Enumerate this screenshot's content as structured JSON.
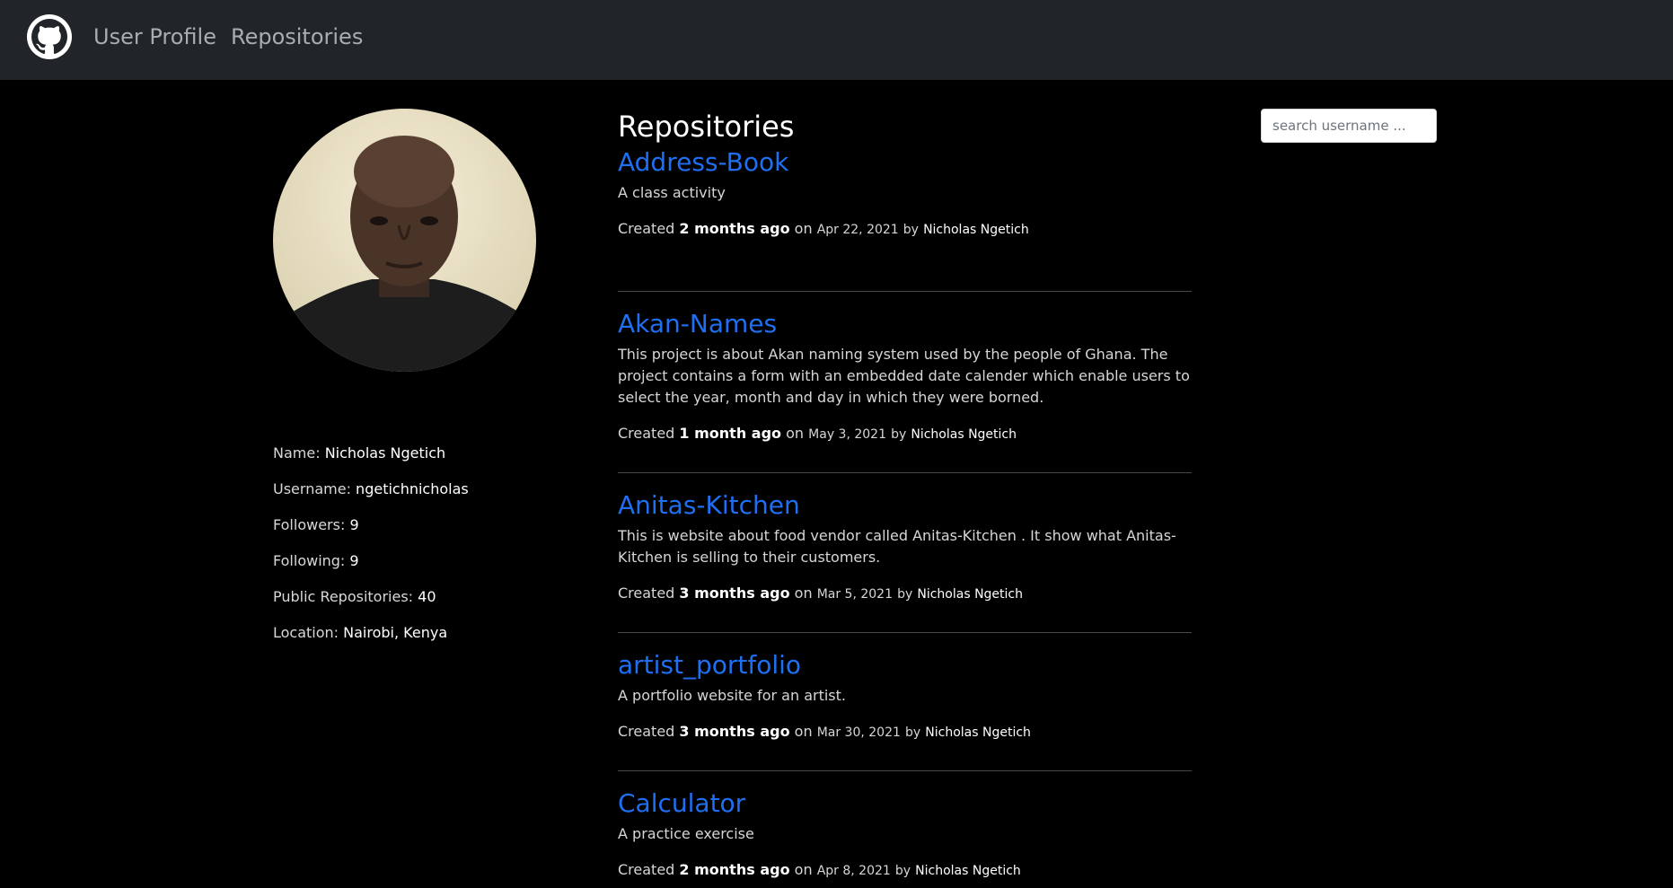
{
  "nav": {
    "brand_icon": "github-icon",
    "links": [
      "User Profile",
      "Repositories"
    ]
  },
  "profile": {
    "avatar_alt": "profile-photo",
    "fields": [
      {
        "label": "Name:",
        "value": "Nicholas Ngetich"
      },
      {
        "label": "Username:",
        "value": "ngetichnicholas"
      },
      {
        "label": "Followers:",
        "value": "9"
      },
      {
        "label": "Following:",
        "value": "9"
      },
      {
        "label": "Public Repositories:",
        "value": "40"
      },
      {
        "label": "Location:",
        "value": "Nairobi, Kenya"
      }
    ]
  },
  "search": {
    "placeholder": "search username ..."
  },
  "repos": {
    "title": "Repositories",
    "items": [
      {
        "name": "Address-Book",
        "description": "A class activity",
        "created_prefix": "Created",
        "ago": "2 months ago",
        "on": "on",
        "date": "Apr 22, 2021",
        "by": "by",
        "owner": "Nicholas Ngetich"
      },
      {
        "name": "Akan-Names",
        "description": "This project is about Akan naming system used by the people of Ghana. The project contains a form with an embedded date calender which enable users to select the year, month and day in which they were borned.",
        "created_prefix": "Created",
        "ago": "1 month ago",
        "on": "on",
        "date": "May 3, 2021",
        "by": "by",
        "owner": "Nicholas Ngetich"
      },
      {
        "name": "Anitas-Kitchen",
        "description": "This is website about food vendor called Anitas-Kitchen . It show what Anitas-Kitchen is selling to their customers.",
        "created_prefix": "Created",
        "ago": "3 months ago",
        "on": "on",
        "date": "Mar 5, 2021",
        "by": "by",
        "owner": "Nicholas Ngetich"
      },
      {
        "name": "artist_portfolio",
        "description": "A portfolio website for an artist.",
        "created_prefix": "Created",
        "ago": "3 months ago",
        "on": "on",
        "date": "Mar 30, 2021",
        "by": "by",
        "owner": "Nicholas Ngetich"
      },
      {
        "name": "Calculator",
        "description": "A practice exercise",
        "created_prefix": "Created",
        "ago": "2 months ago",
        "on": "on",
        "date": "Apr 8, 2021",
        "by": "by",
        "owner": "Nicholas Ngetich"
      }
    ]
  },
  "colors": {
    "navbar_bg": "#212529",
    "page_bg": "#000000",
    "link": "#1e6ff2"
  }
}
